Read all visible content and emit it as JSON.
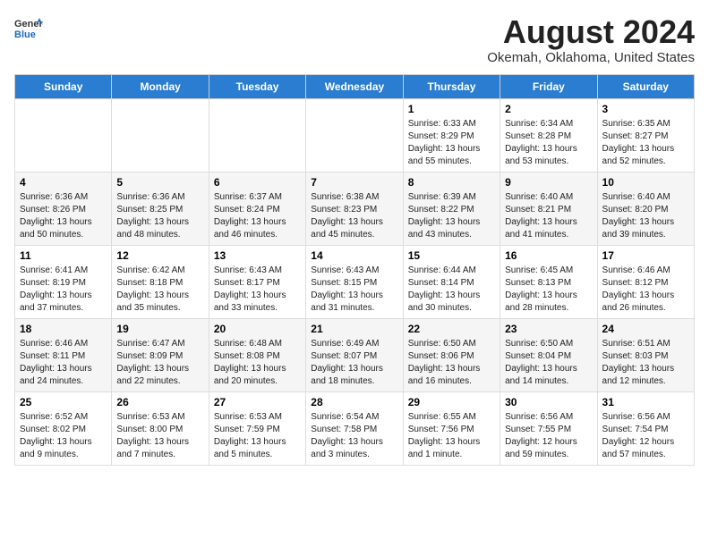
{
  "header": {
    "logo_general": "General",
    "logo_blue": "Blue",
    "month_year": "August 2024",
    "location": "Okemah, Oklahoma, United States"
  },
  "days_of_week": [
    "Sunday",
    "Monday",
    "Tuesday",
    "Wednesday",
    "Thursday",
    "Friday",
    "Saturday"
  ],
  "weeks": [
    [
      {
        "day": "",
        "content": ""
      },
      {
        "day": "",
        "content": ""
      },
      {
        "day": "",
        "content": ""
      },
      {
        "day": "",
        "content": ""
      },
      {
        "day": "1",
        "content": "Sunrise: 6:33 AM\nSunset: 8:29 PM\nDaylight: 13 hours\nand 55 minutes."
      },
      {
        "day": "2",
        "content": "Sunrise: 6:34 AM\nSunset: 8:28 PM\nDaylight: 13 hours\nand 53 minutes."
      },
      {
        "day": "3",
        "content": "Sunrise: 6:35 AM\nSunset: 8:27 PM\nDaylight: 13 hours\nand 52 minutes."
      }
    ],
    [
      {
        "day": "4",
        "content": "Sunrise: 6:36 AM\nSunset: 8:26 PM\nDaylight: 13 hours\nand 50 minutes."
      },
      {
        "day": "5",
        "content": "Sunrise: 6:36 AM\nSunset: 8:25 PM\nDaylight: 13 hours\nand 48 minutes."
      },
      {
        "day": "6",
        "content": "Sunrise: 6:37 AM\nSunset: 8:24 PM\nDaylight: 13 hours\nand 46 minutes."
      },
      {
        "day": "7",
        "content": "Sunrise: 6:38 AM\nSunset: 8:23 PM\nDaylight: 13 hours\nand 45 minutes."
      },
      {
        "day": "8",
        "content": "Sunrise: 6:39 AM\nSunset: 8:22 PM\nDaylight: 13 hours\nand 43 minutes."
      },
      {
        "day": "9",
        "content": "Sunrise: 6:40 AM\nSunset: 8:21 PM\nDaylight: 13 hours\nand 41 minutes."
      },
      {
        "day": "10",
        "content": "Sunrise: 6:40 AM\nSunset: 8:20 PM\nDaylight: 13 hours\nand 39 minutes."
      }
    ],
    [
      {
        "day": "11",
        "content": "Sunrise: 6:41 AM\nSunset: 8:19 PM\nDaylight: 13 hours\nand 37 minutes."
      },
      {
        "day": "12",
        "content": "Sunrise: 6:42 AM\nSunset: 8:18 PM\nDaylight: 13 hours\nand 35 minutes."
      },
      {
        "day": "13",
        "content": "Sunrise: 6:43 AM\nSunset: 8:17 PM\nDaylight: 13 hours\nand 33 minutes."
      },
      {
        "day": "14",
        "content": "Sunrise: 6:43 AM\nSunset: 8:15 PM\nDaylight: 13 hours\nand 31 minutes."
      },
      {
        "day": "15",
        "content": "Sunrise: 6:44 AM\nSunset: 8:14 PM\nDaylight: 13 hours\nand 30 minutes."
      },
      {
        "day": "16",
        "content": "Sunrise: 6:45 AM\nSunset: 8:13 PM\nDaylight: 13 hours\nand 28 minutes."
      },
      {
        "day": "17",
        "content": "Sunrise: 6:46 AM\nSunset: 8:12 PM\nDaylight: 13 hours\nand 26 minutes."
      }
    ],
    [
      {
        "day": "18",
        "content": "Sunrise: 6:46 AM\nSunset: 8:11 PM\nDaylight: 13 hours\nand 24 minutes."
      },
      {
        "day": "19",
        "content": "Sunrise: 6:47 AM\nSunset: 8:09 PM\nDaylight: 13 hours\nand 22 minutes."
      },
      {
        "day": "20",
        "content": "Sunrise: 6:48 AM\nSunset: 8:08 PM\nDaylight: 13 hours\nand 20 minutes."
      },
      {
        "day": "21",
        "content": "Sunrise: 6:49 AM\nSunset: 8:07 PM\nDaylight: 13 hours\nand 18 minutes."
      },
      {
        "day": "22",
        "content": "Sunrise: 6:50 AM\nSunset: 8:06 PM\nDaylight: 13 hours\nand 16 minutes."
      },
      {
        "day": "23",
        "content": "Sunrise: 6:50 AM\nSunset: 8:04 PM\nDaylight: 13 hours\nand 14 minutes."
      },
      {
        "day": "24",
        "content": "Sunrise: 6:51 AM\nSunset: 8:03 PM\nDaylight: 13 hours\nand 12 minutes."
      }
    ],
    [
      {
        "day": "25",
        "content": "Sunrise: 6:52 AM\nSunset: 8:02 PM\nDaylight: 13 hours\nand 9 minutes."
      },
      {
        "day": "26",
        "content": "Sunrise: 6:53 AM\nSunset: 8:00 PM\nDaylight: 13 hours\nand 7 minutes."
      },
      {
        "day": "27",
        "content": "Sunrise: 6:53 AM\nSunset: 7:59 PM\nDaylight: 13 hours\nand 5 minutes."
      },
      {
        "day": "28",
        "content": "Sunrise: 6:54 AM\nSunset: 7:58 PM\nDaylight: 13 hours\nand 3 minutes."
      },
      {
        "day": "29",
        "content": "Sunrise: 6:55 AM\nSunset: 7:56 PM\nDaylight: 13 hours\nand 1 minute."
      },
      {
        "day": "30",
        "content": "Sunrise: 6:56 AM\nSunset: 7:55 PM\nDaylight: 12 hours\nand 59 minutes."
      },
      {
        "day": "31",
        "content": "Sunrise: 6:56 AM\nSunset: 7:54 PM\nDaylight: 12 hours\nand 57 minutes."
      }
    ]
  ]
}
